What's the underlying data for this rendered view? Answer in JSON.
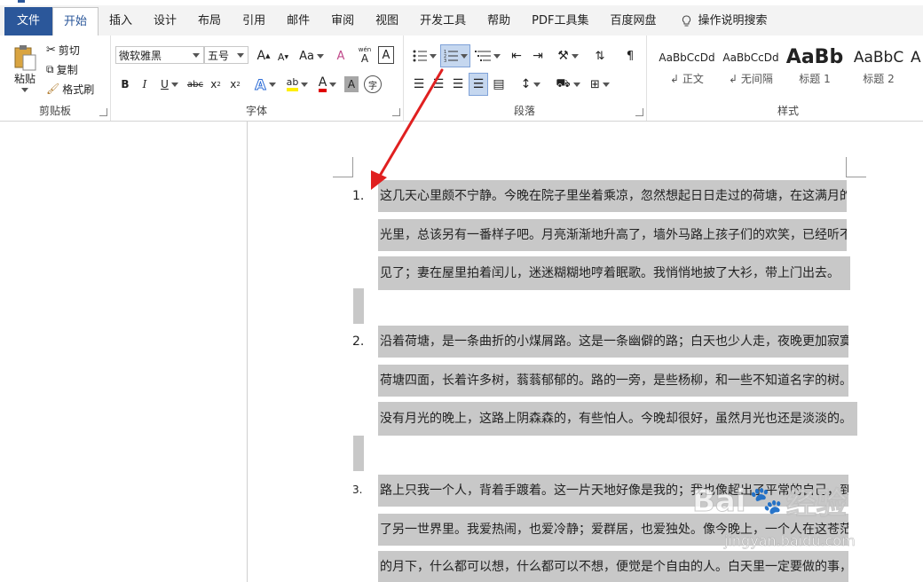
{
  "menu_tabs": {
    "file": "文件",
    "home": "开始",
    "insert": "插入",
    "design": "设计",
    "layout": "布局",
    "references": "引用",
    "mailings": "邮件",
    "review": "审阅",
    "view": "视图",
    "developer": "开发工具",
    "help": "帮助",
    "pdf": "PDF工具集",
    "baidu_pan": "百度网盘",
    "tell_me": "操作说明搜索"
  },
  "clipboard": {
    "paste": "粘贴",
    "cut": "剪切",
    "copy": "复制",
    "format_painter": "格式刷",
    "group_label": "剪贴板"
  },
  "font": {
    "name": "微软雅黑",
    "size": "五号",
    "group_label": "字体",
    "grow": "A",
    "shrink": "A",
    "case": "Aa",
    "clear": "A",
    "phonetic_top": "wén",
    "phonetic": "A",
    "border_char": "A",
    "bold": "B",
    "italic": "I",
    "underline": "U",
    "strike": "abc",
    "subscript": "x",
    "superscript": "x",
    "sub2": "2",
    "sup2": "2",
    "effects": "A",
    "highlight": "ab",
    "font_color": "A",
    "shading": "A",
    "enclose": "字"
  },
  "paragraph": {
    "group_label": "段落"
  },
  "styles": {
    "group_label": "样式",
    "items": [
      {
        "preview": "AaBbCcDd",
        "name": "正文"
      },
      {
        "preview": "AaBbCcDd",
        "name": "无间隔"
      },
      {
        "preview": "AaBb",
        "name": "标题 1"
      },
      {
        "preview": "AaBbC",
        "name": "标题 2"
      },
      {
        "preview": "A",
        "name": ""
      }
    ]
  },
  "document": {
    "paragraphs": [
      {
        "number": "1.",
        "lines": [
          "这几天心里颇不宁静。今晚在院子里坐着乘凉，忽然想起日日走过的荷塘，在这满月的",
          "光里，总该另有一番样子吧。月亮渐渐地升高了，墙外马路上孩子们的欢笑，已经听不",
          "见了；妻在屋里拍着闰儿，迷迷糊糊地哼着眠歌。我悄悄地披了大衫，带上门出去。"
        ]
      },
      {
        "number": "2.",
        "lines": [
          "沿着荷塘，是一条曲折的小煤屑路。这是一条幽僻的路；白天也少人走，夜晚更加寂寞。",
          "荷塘四面，长着许多树，蓊蓊郁郁的。路的一旁，是些杨柳，和一些不知道名字的树。",
          "没有月光的晚上，这路上阴森森的，有些怕人。今晚却很好，虽然月光也还是淡淡的。"
        ]
      },
      {
        "number": "3.",
        "lines": [
          "路上只我一个人，背着手踱着。这一片天地好像是我的；我也像超出了平常的自己，到",
          "了另一世界里。我爱热闹，也爱冷静；爱群居，也爱独处。像今晚上，一个人在这苍茫",
          "的月下，什么都可以想，什么都可以不想，便觉是个自由的人。白天里一定要做的事，"
        ]
      }
    ]
  },
  "watermark": {
    "brand_left": "Bai",
    "brand_right": "经验",
    "url": "jingyan.baidu.com"
  },
  "colors": {
    "accent": "#2b579a",
    "arrow": "#e02020",
    "selection": "#c8c8c8"
  }
}
